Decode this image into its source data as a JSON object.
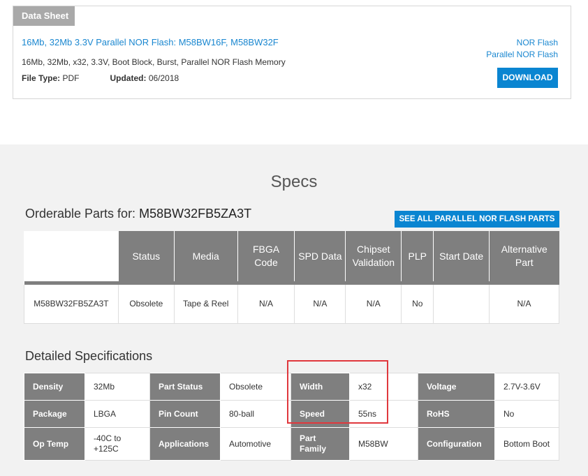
{
  "datasheet": {
    "tag": "Data Sheet",
    "title": "16Mb, 32Mb 3.3V Parallel NOR Flash: M58BW16F, M58BW32F",
    "description": "16Mb, 32Mb, x32, 3.3V, Boot Block, Burst, Parallel NOR Flash Memory",
    "file_type_label": "File Type:",
    "file_type_value": "PDF",
    "updated_label": "Updated:",
    "updated_value": "06/2018",
    "links": [
      "NOR Flash",
      "Parallel NOR Flash"
    ],
    "download_label": "DOWNLOAD"
  },
  "specs": {
    "title": "Specs",
    "orderable_label": "Orderable Parts for:",
    "orderable_part": "M58BW32FB5ZA3T",
    "see_all_label": "SEE ALL PARALLEL NOR FLASH PARTS",
    "columns": [
      "Status",
      "Media",
      "FBGA Code",
      "SPD Data",
      "Chipset Validation",
      "PLP",
      "Start Date",
      "Alternative Part"
    ],
    "row": [
      "M58BW32FB5ZA3T",
      "Obsolete",
      "Tape & Reel",
      "N/A",
      "N/A",
      "N/A",
      "No",
      "",
      "N/A"
    ],
    "detailed_title": "Detailed Specifications",
    "detailed": [
      [
        [
          "Density",
          "32Mb"
        ],
        [
          "Part Status",
          "Obsolete"
        ],
        [
          "Width",
          "x32"
        ],
        [
          "Voltage",
          "2.7V-3.6V"
        ]
      ],
      [
        [
          "Package",
          "LBGA"
        ],
        [
          "Pin Count",
          "80-ball"
        ],
        [
          "Speed",
          "55ns"
        ],
        [
          "RoHS",
          "No"
        ]
      ],
      [
        [
          "Op Temp",
          "-40C to +125C"
        ],
        [
          "Applications",
          "Automotive"
        ],
        [
          "Part Family",
          "M58BW"
        ],
        [
          "Configuration",
          "Bottom Boot"
        ]
      ]
    ]
  },
  "colors": {
    "accent": "#0a85d1",
    "link": "#1a87d0",
    "header_gray": "#7f7f7f",
    "highlight": "#e0383d"
  }
}
